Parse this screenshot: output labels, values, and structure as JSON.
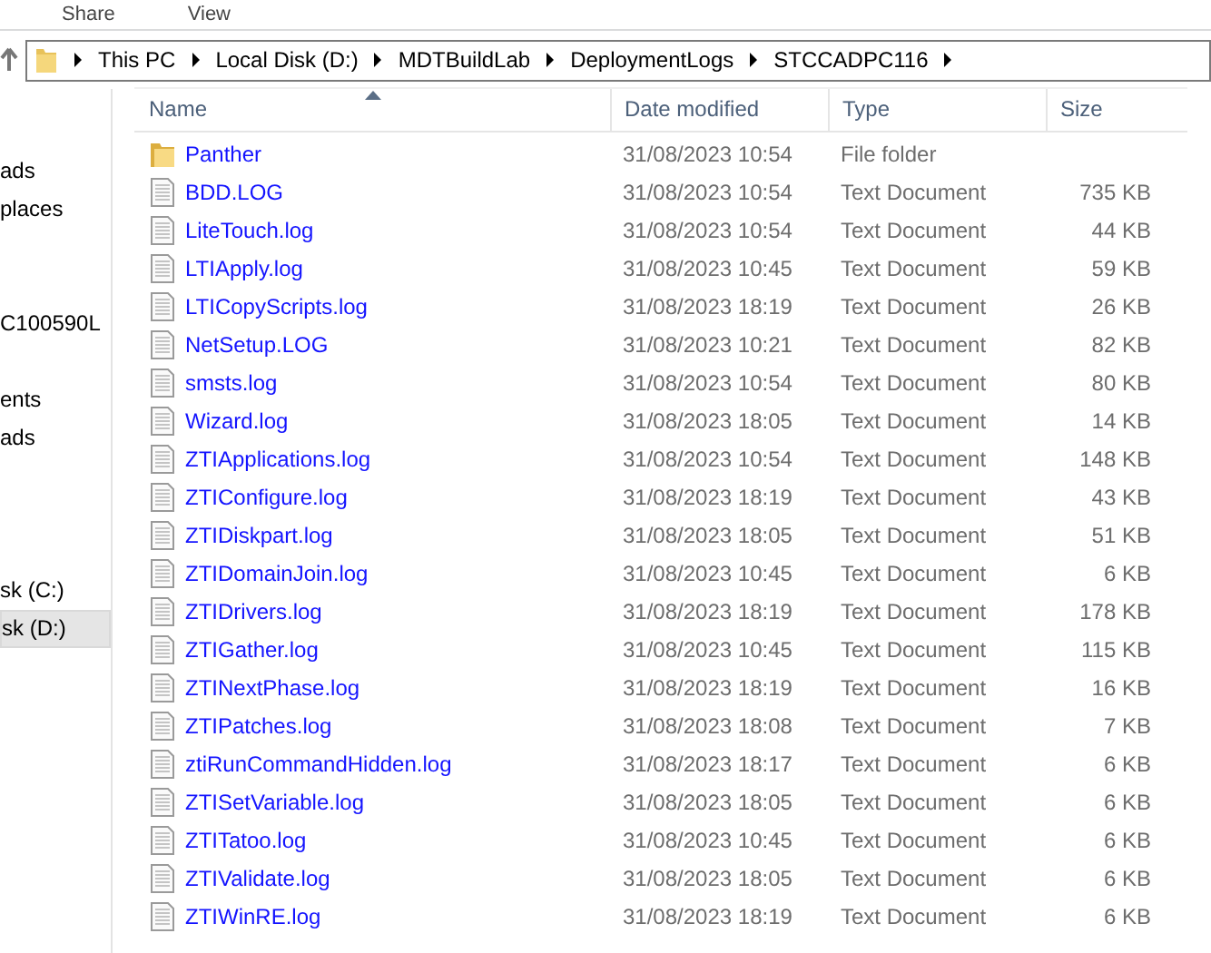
{
  "ribbon_tabs": [
    {
      "label": "Share"
    },
    {
      "label": "View"
    }
  ],
  "address_bar": {
    "segments": [
      "This PC",
      "Local Disk (D:)",
      "MDTBuildLab",
      "DeploymentLogs",
      "STCCADPC116"
    ]
  },
  "sidebar": {
    "groups": [
      {
        "items": [
          {
            "label": "ads",
            "selected": false
          },
          {
            "label": "places",
            "selected": false
          }
        ]
      },
      {
        "items": [
          {
            "label": "C100590L",
            "selected": false
          }
        ]
      },
      {
        "items": [
          {
            "label": "ents",
            "selected": false
          },
          {
            "label": "ads",
            "selected": false
          }
        ]
      },
      {
        "items": [
          {
            "label": "sk (C:)",
            "selected": false
          },
          {
            "label": "sk (D:)",
            "selected": true
          }
        ]
      }
    ]
  },
  "table": {
    "columns": [
      {
        "label": "Name",
        "sorted": true
      },
      {
        "label": "Date modified",
        "sorted": false
      },
      {
        "label": "Type",
        "sorted": false
      },
      {
        "label": "Size",
        "sorted": false
      }
    ],
    "rows": [
      {
        "kind": "folder",
        "name": "Panther",
        "date": "31/08/2023 10:54",
        "type": "File folder"
      },
      {
        "kind": "file",
        "name": "BDD.LOG",
        "date": "31/08/2023 10:54",
        "type": "Text Document",
        "size": "735 KB"
      },
      {
        "kind": "file",
        "name": "LiteTouch.log",
        "date": "31/08/2023 10:54",
        "type": "Text Document",
        "size": "44 KB"
      },
      {
        "kind": "file",
        "name": "LTIApply.log",
        "date": "31/08/2023 10:45",
        "type": "Text Document",
        "size": "59 KB"
      },
      {
        "kind": "file",
        "name": "LTICopyScripts.log",
        "date": "31/08/2023 18:19",
        "type": "Text Document",
        "size": "26 KB"
      },
      {
        "kind": "file",
        "name": "NetSetup.LOG",
        "date": "31/08/2023 10:21",
        "type": "Text Document",
        "size": "82 KB"
      },
      {
        "kind": "file",
        "name": "smsts.log",
        "date": "31/08/2023 10:54",
        "type": "Text Document",
        "size": "80 KB"
      },
      {
        "kind": "file",
        "name": "Wizard.log",
        "date": "31/08/2023 18:05",
        "type": "Text Document",
        "size": "14 KB"
      },
      {
        "kind": "file",
        "name": "ZTIApplications.log",
        "date": "31/08/2023 10:54",
        "type": "Text Document",
        "size": "148 KB"
      },
      {
        "kind": "file",
        "name": "ZTIConfigure.log",
        "date": "31/08/2023 18:19",
        "type": "Text Document",
        "size": "43 KB"
      },
      {
        "kind": "file",
        "name": "ZTIDiskpart.log",
        "date": "31/08/2023 18:05",
        "type": "Text Document",
        "size": "51 KB"
      },
      {
        "kind": "file",
        "name": "ZTIDomainJoin.log",
        "date": "31/08/2023 10:45",
        "type": "Text Document",
        "size": "6 KB"
      },
      {
        "kind": "file",
        "name": "ZTIDrivers.log",
        "date": "31/08/2023 18:19",
        "type": "Text Document",
        "size": "178 KB"
      },
      {
        "kind": "file",
        "name": "ZTIGather.log",
        "date": "31/08/2023 10:45",
        "type": "Text Document",
        "size": "115 KB"
      },
      {
        "kind": "file",
        "name": "ZTINextPhase.log",
        "date": "31/08/2023 18:19",
        "type": "Text Document",
        "size": "16 KB"
      },
      {
        "kind": "file",
        "name": "ZTIPatches.log",
        "date": "31/08/2023 18:08",
        "type": "Text Document",
        "size": "7 KB"
      },
      {
        "kind": "file",
        "name": "ztiRunCommandHidden.log",
        "date": "31/08/2023 18:17",
        "type": "Text Document",
        "size": "6 KB"
      },
      {
        "kind": "file",
        "name": "ZTISetVariable.log",
        "date": "31/08/2023 18:05",
        "type": "Text Document",
        "size": "6 KB"
      },
      {
        "kind": "file",
        "name": "ZTITatoo.log",
        "date": "31/08/2023 10:45",
        "type": "Text Document",
        "size": "6 KB"
      },
      {
        "kind": "file",
        "name": "ZTIValidate.log",
        "date": "31/08/2023 18:05",
        "type": "Text Document",
        "size": "6 KB"
      },
      {
        "kind": "file",
        "name": "ZTIWinRE.log",
        "date": "31/08/2023 18:19",
        "type": "Text Document",
        "size": "6 KB"
      }
    ]
  }
}
